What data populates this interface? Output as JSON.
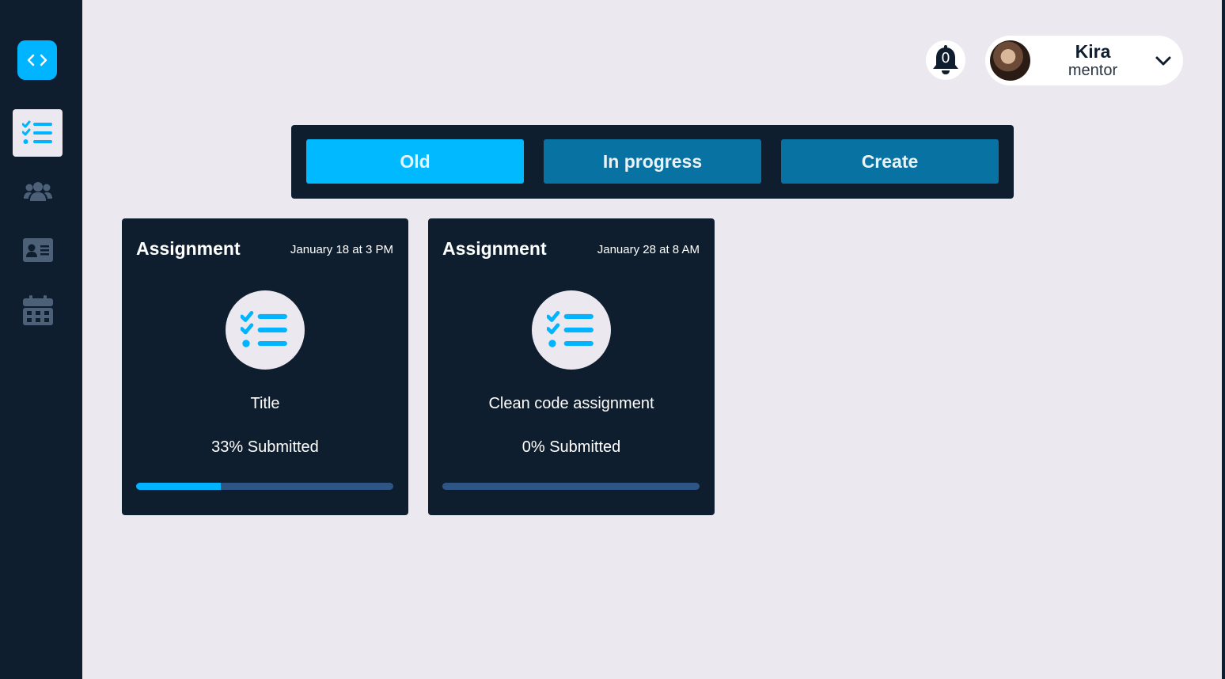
{
  "sidebar": {
    "logo_icon": "code-icon",
    "items": [
      {
        "name": "assignments",
        "icon": "tasks-list-icon",
        "active": true
      },
      {
        "name": "groups",
        "icon": "users-icon",
        "active": false
      },
      {
        "name": "profile",
        "icon": "id-card-icon",
        "active": false
      },
      {
        "name": "calendar",
        "icon": "calendar-icon",
        "active": false
      }
    ]
  },
  "header": {
    "notification_count": "0",
    "user": {
      "name": "Kira",
      "role": "mentor"
    }
  },
  "tabs": [
    {
      "label": "Old",
      "active": true
    },
    {
      "label": "In progress",
      "active": false
    },
    {
      "label": "Create",
      "active": false
    }
  ],
  "cards": [
    {
      "type": "Assignment",
      "date": "January 18 at 3 PM",
      "title": "Title",
      "submitted_label": "33% Submitted",
      "progress": 0.33
    },
    {
      "type": "Assignment",
      "date": "January 28 at 8 AM",
      "title": "Clean code assignment",
      "submitted_label": "0% Submitted",
      "progress": 0
    }
  ],
  "colors": {
    "accent": "#00b4ff",
    "sidebar_bg": "#0f1e2e",
    "page_bg": "#ebe8ef",
    "tab_inactive": "#0872a2",
    "progress_track": "#2f5585"
  }
}
